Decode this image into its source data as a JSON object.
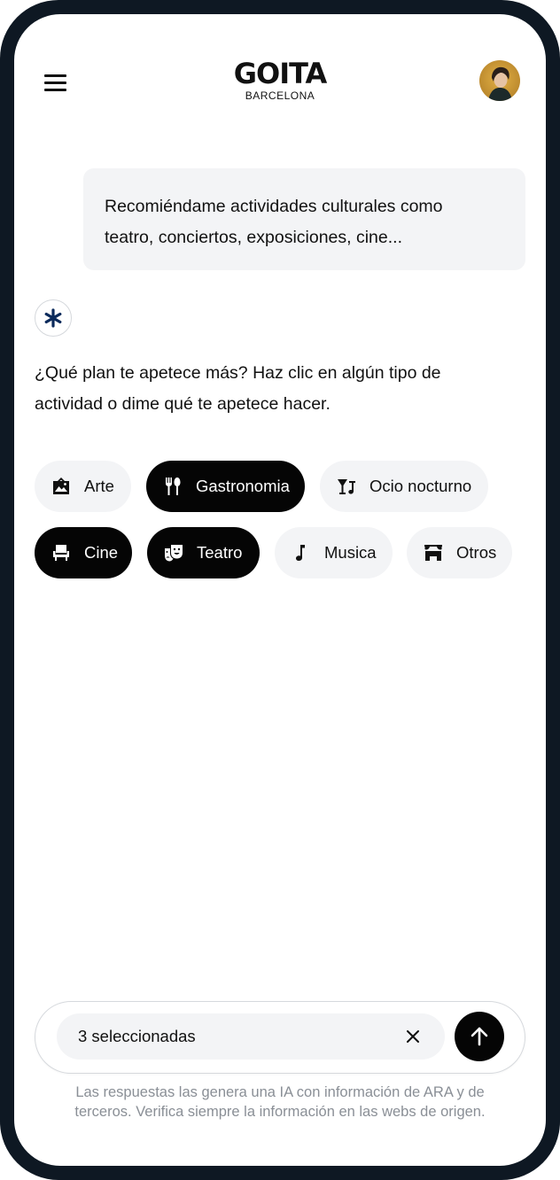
{
  "header": {
    "logo_title": "GOITA",
    "logo_subtitle": "BARCELONA",
    "menu_icon": "hamburger-menu-icon",
    "avatar_icon": "user-avatar"
  },
  "conversation": {
    "user_message_line1": "Recomiéndame actividades culturales como",
    "user_message_line2": "teatro, conciertos, exposiciones, cine...",
    "bot_icon": "asterisk-icon",
    "bot_icon_color": "#0b2a5b",
    "bot_message_line1": "¿Qué plan te apetece más? Haz clic en algún tipo de",
    "bot_message_line2": "actividad o dime qué te apetece hacer."
  },
  "categories": [
    {
      "label": "Arte",
      "icon": "picture-frame-icon",
      "selected": false
    },
    {
      "label": "Gastronomia",
      "icon": "fork-spoon-icon",
      "selected": true
    },
    {
      "label": "Ocio nocturno",
      "icon": "cocktail-music-icon",
      "selected": false
    },
    {
      "label": "Cine",
      "icon": "cinema-seat-icon",
      "selected": true
    },
    {
      "label": "Teatro",
      "icon": "theater-masks-icon",
      "selected": true
    },
    {
      "label": "Musica",
      "icon": "music-note-icon",
      "selected": false
    },
    {
      "label": "Otros",
      "icon": "stage-icon",
      "selected": false
    }
  ],
  "input": {
    "value": "3 seleccionadas",
    "clear_icon": "close-icon",
    "send_icon": "arrow-up-icon"
  },
  "disclaimer_line1": "Las respuestas las genera una IA con información de ARA y de",
  "disclaimer_line2": "terceros. Verifica siempre la información en las webs de origen.",
  "colors": {
    "frame": "#0e1823",
    "chip_selected": "#050505",
    "chip_unselected": "#f3f4f6",
    "bubble": "#f3f4f6",
    "disclaimer_text": "#8a8f96"
  }
}
